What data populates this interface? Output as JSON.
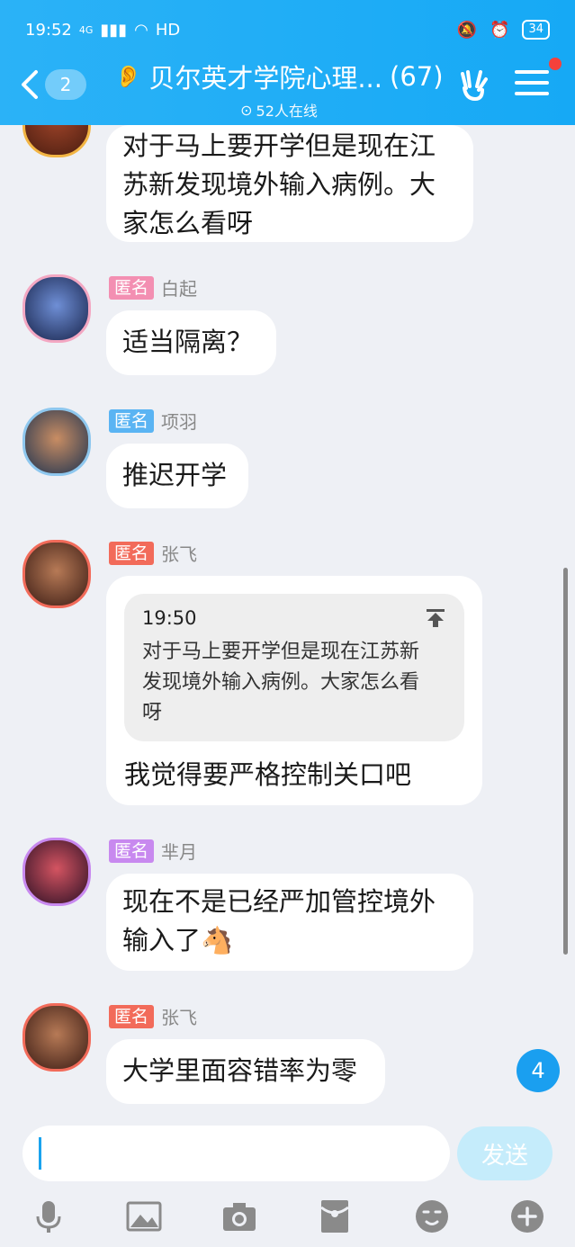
{
  "status_bar": {
    "time": "19:52",
    "network": "4G",
    "hd": "HD",
    "battery": "34"
  },
  "header": {
    "back_count": "2",
    "title": "贝尔英才学院心理...",
    "member_count": "(67)",
    "online": "52人在线"
  },
  "messages": [
    {
      "bubble": [
        "对于马上要开学但是现在江",
        "苏新发现境外输入病例。大",
        "家怎么看呀"
      ]
    },
    {
      "tag": "匿名",
      "tag_color": "#f38fb2",
      "nick": "白起",
      "text": "适当隔离？"
    },
    {
      "tag": "匿名",
      "tag_color": "#5ab4f3",
      "nick": "项羽",
      "text": "推迟开学"
    },
    {
      "tag": "匿名",
      "tag_color": "#f26b5a",
      "nick": "张飞",
      "quote_time": "19:50",
      "quote_lines": [
        "对于马上要开学但是现在江苏新",
        "发现境外输入病例。大家怎么看",
        "呀"
      ],
      "text": "我觉得要严格控制关口吧"
    },
    {
      "tag": "匿名",
      "tag_color": "#c889ef",
      "nick": "芈月",
      "lines": [
        "现在不是已经严加管控境外",
        "输入了🐴"
      ]
    },
    {
      "tag": "匿名",
      "tag_color": "#f26b5a",
      "nick": "张飞",
      "text": "大学里面容错率为零"
    }
  ],
  "unread_badge": "4",
  "composer": {
    "send_label": "发送"
  },
  "toolbar_icons": [
    "microphone-icon",
    "image-icon",
    "camera-icon",
    "red-packet-icon",
    "emoji-icon",
    "plus-icon"
  ]
}
